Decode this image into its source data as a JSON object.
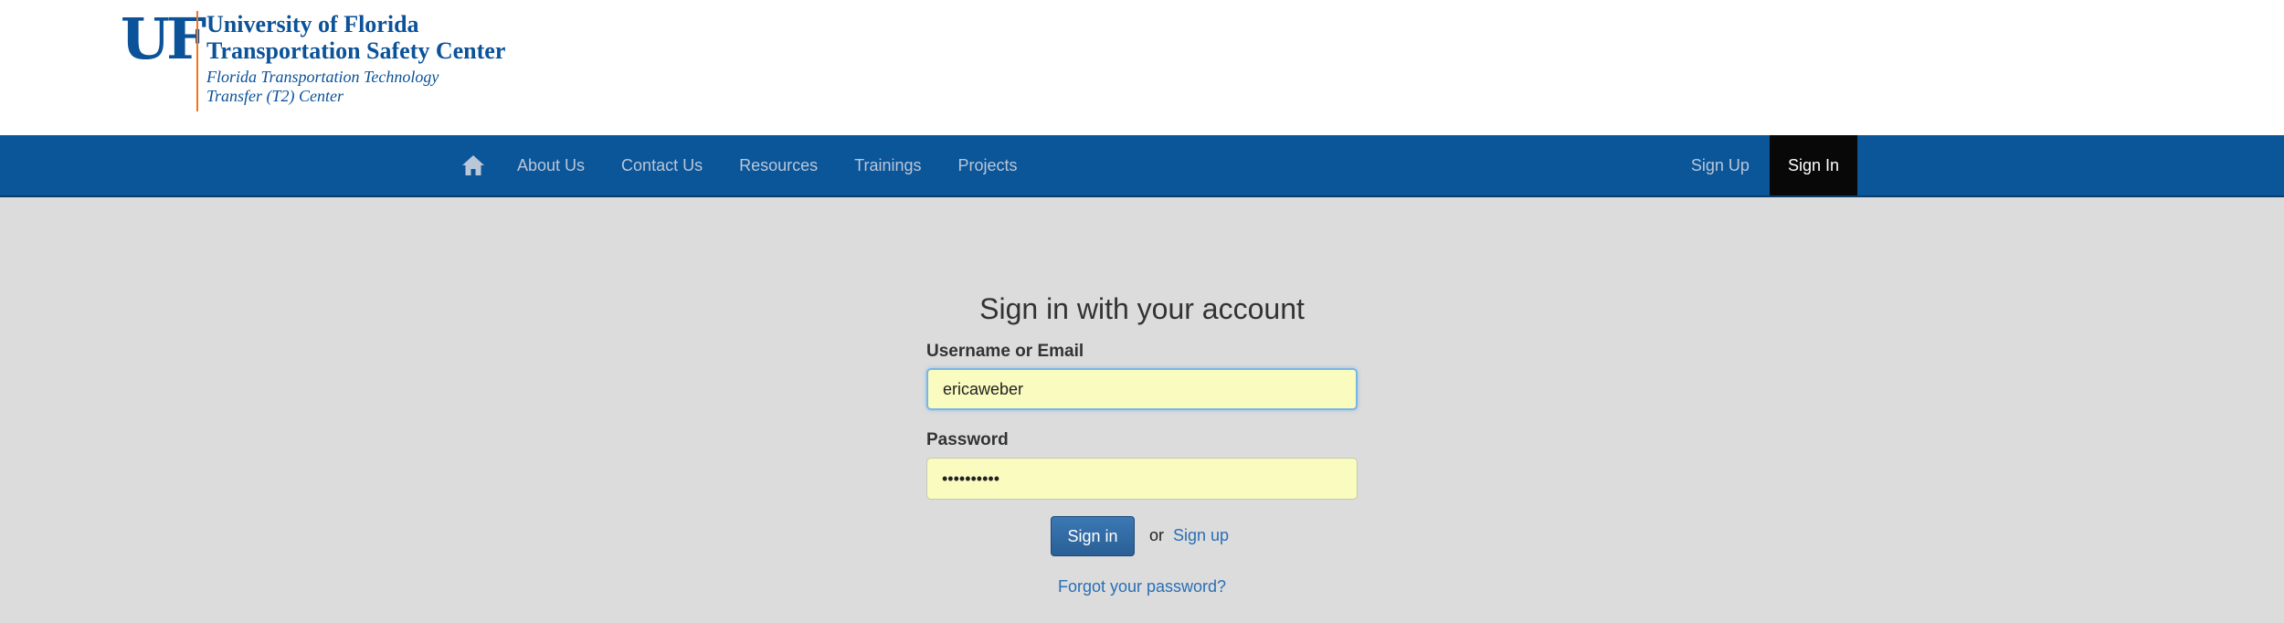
{
  "header": {
    "logo_mark": "UF",
    "logo_line1": "University of Florida",
    "logo_line2": "Transportation Safety Center",
    "logo_line3": "Florida Transportation Technology",
    "logo_line4": "Transfer (T2) Center"
  },
  "navbar": {
    "home_icon": "home-icon",
    "items": [
      {
        "label": "About Us"
      },
      {
        "label": "Contact Us"
      },
      {
        "label": "Resources"
      },
      {
        "label": "Trainings"
      },
      {
        "label": "Projects"
      }
    ],
    "signup_label": "Sign Up",
    "signin_label": "Sign In"
  },
  "form": {
    "title": "Sign in with your account",
    "username_label": "Username or Email",
    "username_value": "ericaweber",
    "password_label": "Password",
    "password_value": "••••••••••",
    "submit_label": "Sign in",
    "or_text": "or",
    "signup_link": "Sign up",
    "forgot_link": "Forgot your password?"
  },
  "colors": {
    "brand_blue": "#0b5599",
    "nav_active_bg": "#080808",
    "input_autofill_bg": "#f9fbbf",
    "link_blue": "#2a6fb5",
    "accent_orange": "#f37321"
  }
}
